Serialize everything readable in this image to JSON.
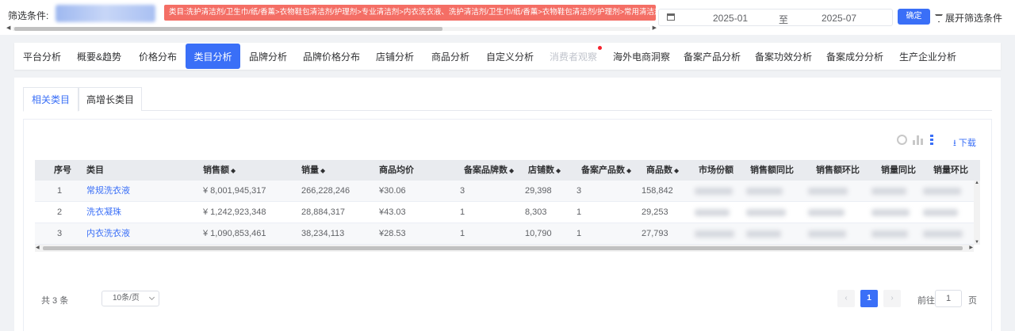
{
  "filter": {
    "label": "筛选条件:",
    "category_tag": "类目:洗护清洁剂/卫生巾/纸/香薰>衣物鞋包清洁剂/护理剂>专业清洁剂>内衣洗衣液、洗护清洁剂/卫生巾/纸/香薰>衣物鞋包清洁剂/护理剂>常用清洁剂>常规洗衣液",
    "date_start": "2025-01",
    "date_to": "至",
    "date_end": "2025-07",
    "confirm_label": "确定",
    "expand_label": "展开筛选条件"
  },
  "nav": {
    "tabs": [
      {
        "label": "平台分析"
      },
      {
        "label": "概要&趋势"
      },
      {
        "label": "价格分布"
      },
      {
        "label": "类目分析"
      },
      {
        "label": "品牌分析"
      },
      {
        "label": "品牌价格分布"
      },
      {
        "label": "店铺分析"
      },
      {
        "label": "商品分析"
      },
      {
        "label": "自定义分析"
      },
      {
        "label": "消费者观察"
      },
      {
        "label": "海外电商洞察"
      },
      {
        "label": "备案产品分析"
      },
      {
        "label": "备案功效分析"
      },
      {
        "label": "备案成分分析"
      },
      {
        "label": "生产企业分析"
      }
    ],
    "active": "类目分析"
  },
  "subtabs": [
    {
      "label": "相关类目"
    },
    {
      "label": "高增长类目"
    }
  ],
  "toolbar": {
    "download_label": "下载"
  },
  "table": {
    "headers": [
      "序号",
      "类目",
      "销售额",
      "销量",
      "商品均价",
      "备案品牌数",
      "店铺数",
      "备案产品数",
      "商品数",
      "市场份额",
      "销售额同比",
      "销售额环比",
      "销量同比",
      "销量环比"
    ],
    "rows": [
      {
        "idx": "1",
        "category": "常规洗衣液",
        "sales": "¥ 8,001,945,317",
        "volume": "266,228,246",
        "avg_price": "¥30.06",
        "brands": "3",
        "shops": "29,398",
        "products_filed": "3",
        "products": "158,842"
      },
      {
        "idx": "2",
        "category": "洗衣凝珠",
        "sales": "¥ 1,242,923,348",
        "volume": "28,884,317",
        "avg_price": "¥43.03",
        "brands": "1",
        "shops": "8,303",
        "products_filed": "1",
        "products": "29,253"
      },
      {
        "idx": "3",
        "category": "内衣洗衣液",
        "sales": "¥ 1,090,853,461",
        "volume": "38,234,113",
        "avg_price": "¥28.53",
        "brands": "1",
        "shops": "10,790",
        "products_filed": "1",
        "products": "27,793"
      }
    ]
  },
  "pagination": {
    "total_label": "共 3 条",
    "page_size": "10条/页",
    "current_page": "1",
    "prev": "‹",
    "next": "›",
    "goto_prefix": "前往",
    "goto_value": "1",
    "goto_suffix": "页"
  },
  "colors": {
    "accent": "#3a6ff7",
    "tag": "#f46e65"
  }
}
